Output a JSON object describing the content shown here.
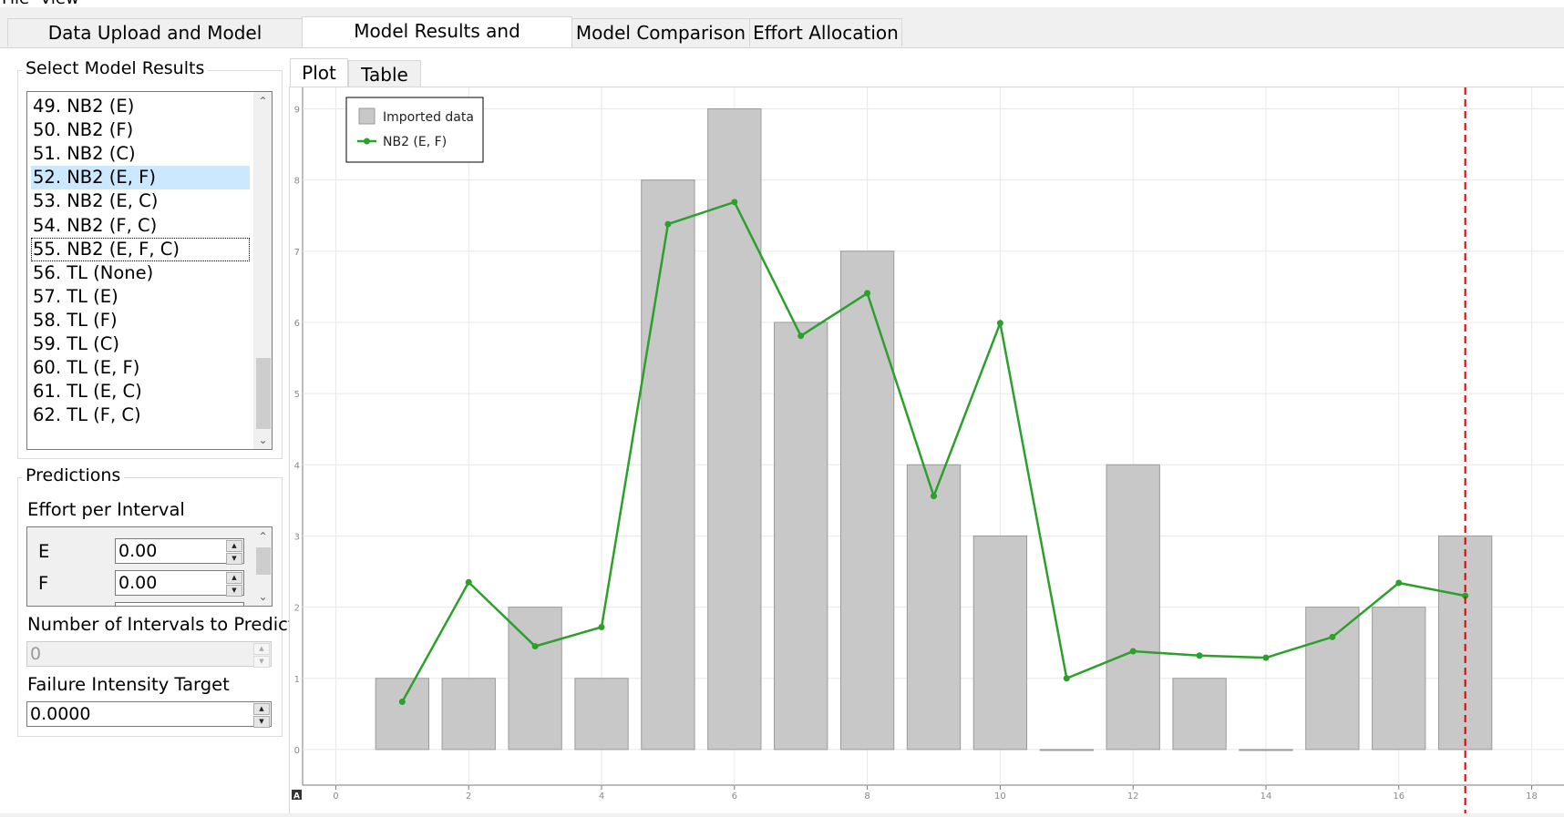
{
  "menu": {
    "file": "File",
    "view": "View"
  },
  "main_tabs": [
    {
      "label": "Data Upload and Model Selection",
      "active": false
    },
    {
      "label": "Model Results and Predictions",
      "active": true
    },
    {
      "label": "Model Comparison",
      "active": false
    },
    {
      "label": "Effort Allocation",
      "active": false
    }
  ],
  "model_results": {
    "title": "Select Model Results",
    "items": [
      "49. NB2 (E)",
      "50. NB2 (F)",
      "51. NB2 (C)",
      "52. NB2 (E, F)",
      "53. NB2 (E, C)",
      "54. NB2 (F, C)",
      "55. NB2 (E, F, C)",
      "56. TL (None)",
      "57. TL (E)",
      "58. TL (F)",
      "59. TL (C)",
      "60. TL (E, F)",
      "61. TL (E, C)",
      "62. TL (F, C)"
    ],
    "selected": "52. NB2 (E, F)",
    "focused": "55. NB2 (E, F, C)"
  },
  "predictions": {
    "title": "Predictions",
    "effort_label": "Effort per Interval",
    "effort_rows": [
      {
        "name": "E",
        "value": "0.00"
      },
      {
        "name": "F",
        "value": "0.00"
      }
    ],
    "intervals_label": "Number of Intervals to Predict",
    "intervals_value": "0",
    "intensity_label": "Failure Intensity Target",
    "intensity_value": "0.0000"
  },
  "plot_tabs": [
    {
      "label": "Plot",
      "active": true
    },
    {
      "label": "Table",
      "active": false
    }
  ],
  "plot_corner_badge": "A",
  "colors": {
    "bars": "#c8c8c8",
    "bar_edge": "#9a9a9a",
    "line": "#2ca02c",
    "marker_line": "#e00000"
  },
  "chart_data": {
    "type": "bar",
    "legend": {
      "placement": "top-left",
      "entries": [
        "Imported data",
        "NB2 (E, F)"
      ]
    },
    "x_ticks": [
      "0",
      "2",
      "4",
      "6",
      "8",
      "10",
      "12",
      "14",
      "16",
      "18"
    ],
    "y_ticks": [
      "0",
      "1",
      "2",
      "3",
      "4",
      "5",
      "6",
      "7",
      "8",
      "9"
    ],
    "xlim": [
      -0.5,
      18.5
    ],
    "ylim": [
      -0.5,
      9.3
    ],
    "grid": true,
    "categories": [
      1,
      2,
      3,
      4,
      5,
      6,
      7,
      8,
      9,
      10,
      11,
      12,
      13,
      14,
      15,
      16,
      17
    ],
    "series": [
      {
        "name": "Imported data",
        "type": "bar",
        "values": [
          1,
          1,
          2,
          1,
          8,
          9,
          6,
          7,
          4,
          3,
          0,
          4,
          1,
          0,
          2,
          2,
          3
        ]
      },
      {
        "name": "NB2 (E, F)",
        "type": "line",
        "values": [
          0.67,
          2.35,
          1.45,
          1.72,
          7.38,
          7.69,
          5.81,
          6.41,
          3.56,
          5.99,
          1.0,
          1.38,
          1.32,
          1.29,
          1.58,
          2.34,
          2.16
        ]
      }
    ],
    "vertical_marker_x": 17
  }
}
